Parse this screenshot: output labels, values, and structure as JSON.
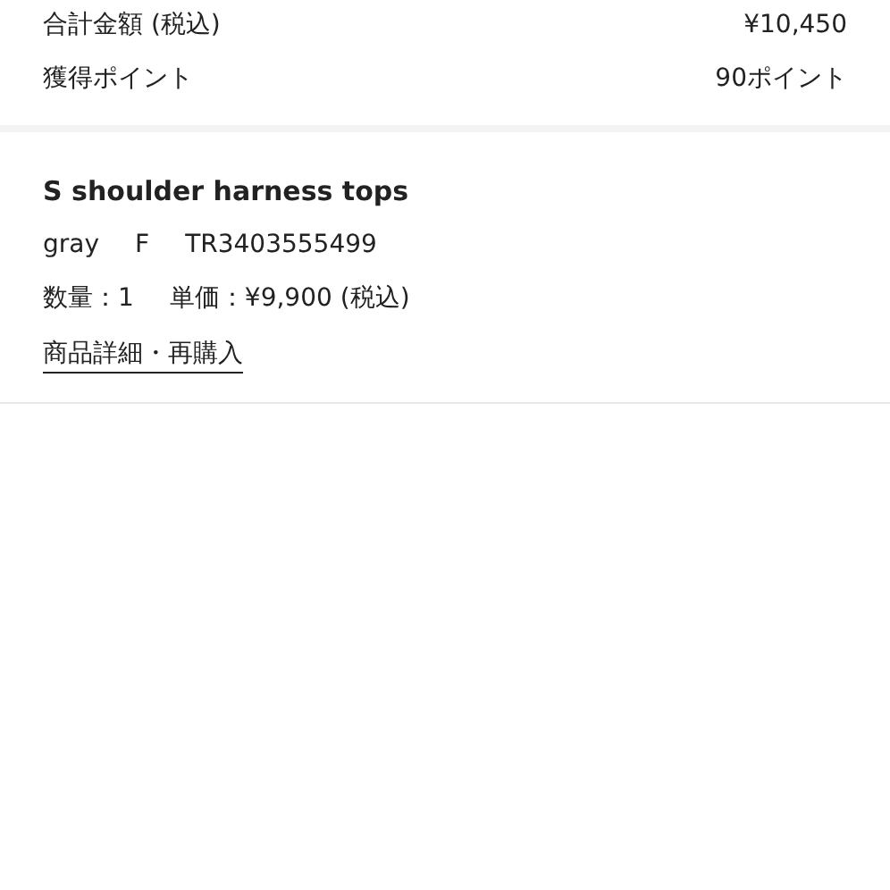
{
  "summary": [
    {
      "label": "合計金額 (税込)",
      "value": "¥10,450"
    },
    {
      "label": "獲得ポイント",
      "value": "90ポイント"
    }
  ],
  "item": {
    "name": "S shoulder harness tops",
    "variant": "gray",
    "size": "F",
    "code": "TR3403555499",
    "quantity": "数量：1",
    "unit_price": "単価：¥9,900 (税込)",
    "link": "商品詳細・再購入"
  }
}
